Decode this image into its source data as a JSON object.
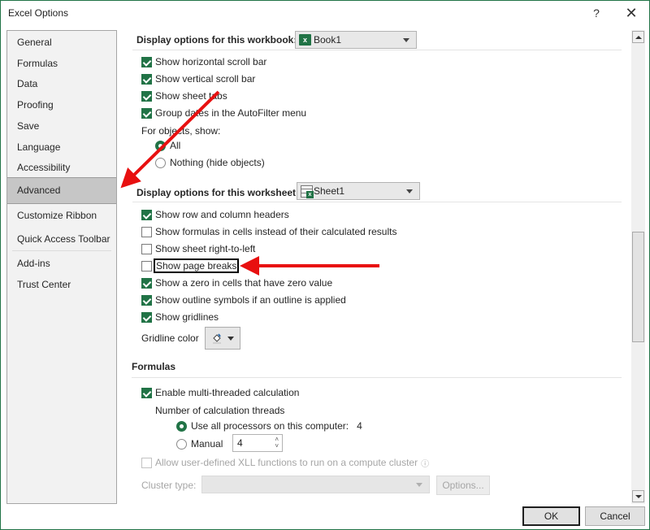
{
  "window": {
    "title": "Excel Options",
    "help_label": "?",
    "close_label": "✕"
  },
  "sidebar": {
    "items": [
      {
        "label": "General"
      },
      {
        "label": "Formulas"
      },
      {
        "label": "Data"
      },
      {
        "label": "Proofing"
      },
      {
        "label": "Save"
      },
      {
        "label": "Language"
      },
      {
        "label": "Accessibility"
      },
      {
        "label": "Advanced",
        "selected": true
      },
      {
        "label": "Customize Ribbon"
      },
      {
        "label": "Quick Access Toolbar"
      },
      {
        "label": "Add-ins"
      },
      {
        "label": "Trust Center"
      }
    ]
  },
  "workbook_section": {
    "heading": "Display options for this workbook:",
    "combo_value": "Book1",
    "combo_icon": "excel-workbook-icon",
    "options": [
      {
        "label": "Show horizontal scroll bar",
        "checked": true
      },
      {
        "label": "Show vertical scroll bar",
        "checked": true
      },
      {
        "label": "Show sheet tabs",
        "checked": true
      },
      {
        "label": "Group dates in the AutoFilter menu",
        "checked": true
      }
    ],
    "objects_label": "For objects, show:",
    "objects_radios": [
      {
        "label": "All",
        "selected": true
      },
      {
        "label": "Nothing (hide objects)",
        "selected": false
      }
    ]
  },
  "worksheet_section": {
    "heading": "Display options for this worksheet:",
    "combo_value": "Sheet1",
    "combo_icon": "excel-sheet-icon",
    "options": [
      {
        "label": "Show row and column headers",
        "checked": true
      },
      {
        "label": "Show formulas in cells instead of their calculated results",
        "checked": false
      },
      {
        "label": "Show sheet right-to-left",
        "checked": false
      },
      {
        "label": "Show page breaks",
        "checked": false,
        "focused": true
      },
      {
        "label": "Show a zero in cells that have zero value",
        "checked": true
      },
      {
        "label": "Show outline symbols if an outline is applied",
        "checked": true
      },
      {
        "label": "Show gridlines",
        "checked": true
      }
    ],
    "gridline_color_label": "Gridline color",
    "gridline_color_icon": "paint-bucket-icon"
  },
  "formulas_section": {
    "heading": "Formulas",
    "multithread": {
      "label": "Enable multi-threaded calculation",
      "checked": true
    },
    "threads_label": "Number of calculation threads",
    "thread_radios": [
      {
        "label": "Use all processors on this computer:",
        "value": "4",
        "selected": true
      },
      {
        "label": "Manual",
        "selected": false
      }
    ],
    "manual_value": "4",
    "xll": {
      "label": "Allow user-defined XLL functions to run on a compute cluster",
      "checked": false,
      "disabled": true,
      "info_icon": "info-icon"
    },
    "cluster_type_label": "Cluster type:",
    "cluster_type_value": "",
    "options_button": "Options..."
  },
  "footer": {
    "ok_label": "OK",
    "cancel_label": "Cancel"
  },
  "annotations": {
    "arrow_color": "#e81010",
    "arrows": [
      "points-to-advanced",
      "points-to-show-page-breaks"
    ]
  },
  "colors": {
    "accent": "#217346",
    "selected_nav": "#c6c6c6"
  },
  "scrollbar": {
    "position_fraction": 0.56
  }
}
